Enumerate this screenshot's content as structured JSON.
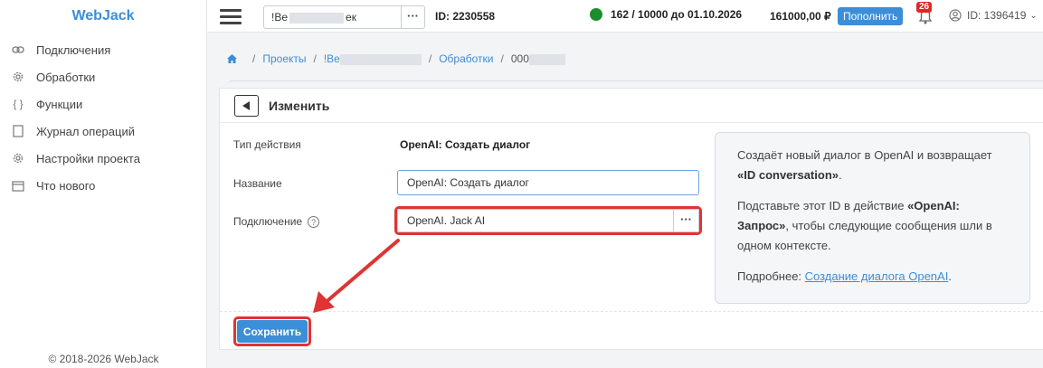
{
  "app": {
    "logo": "WebJack",
    "copyright": "© 2018-2026 WebJack"
  },
  "sidebar": {
    "items": [
      {
        "label": "Подключения",
        "icon": "link-icon"
      },
      {
        "label": "Обработки",
        "icon": "gear-icon"
      },
      {
        "label": "Функции",
        "icon": "braces-icon"
      },
      {
        "label": "Журнал операций",
        "icon": "document-icon"
      },
      {
        "label": "Настройки проекта",
        "icon": "gear-icon"
      },
      {
        "label": "Что нового",
        "icon": "calendar-icon"
      }
    ]
  },
  "header": {
    "project_prefix": "!Be",
    "project_suffix": "ек",
    "project_id": "ID: 2230558",
    "status_dot_color": "#1a8f2c",
    "usage": "162 / 10000 до 01.10.2026",
    "balance": "161000,00 ₽",
    "topup_label": "Пополнить",
    "notifications_count": "26",
    "user_id": "ID: 1396419"
  },
  "breadcrumb": {
    "projects": "Проекты",
    "project_prefix": "!Be",
    "processing": "Обработки",
    "current_prefix": "000"
  },
  "form": {
    "title": "Изменить",
    "action_type_label": "Тип действия",
    "action_type_value": "OpenAI: Создать диалог",
    "name_label": "Название",
    "name_value": "OpenAI: Создать диалог",
    "connection_label": "Подключение",
    "connection_value": "OpenAI. Jack AI",
    "save_label": "Сохранить"
  },
  "info": {
    "p1_text": "Создаёт новый диалог в OpenAI и возвращает ",
    "p1_bold": "«ID conversation»",
    "p1_end": ".",
    "p2_start": "Подставьте этот ID в действие ",
    "p2_bold": "«OpenAI: Запрос»",
    "p2_end": ", чтобы следующие сообщения шли в одном контексте.",
    "p3_start": "Подробнее: ",
    "p3_link": "Создание диалога OpenAI",
    "p3_end": "."
  },
  "colors": {
    "accent": "#3b8ed8",
    "highlight": "#e03333"
  }
}
